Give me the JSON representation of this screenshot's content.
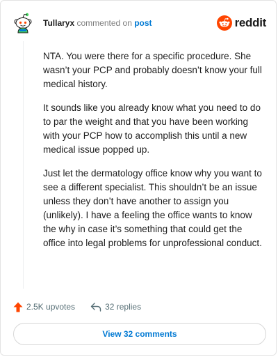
{
  "header": {
    "username": "Tullaryx",
    "verb": "commented on",
    "post_link": "post",
    "brand_wordmark": "reddit",
    "brand_color": "#ff4500"
  },
  "comment": {
    "paragraphs": [
      "NTA. You were there for a specific procedure. She wasn’t your PCP and probably doesn’t know your full medical history.",
      "It sounds like you already know what you need to do to par the weight and that you have been working with your PCP how to accomplish this until a new medical issue popped up.",
      "Just let the dermatology office know why you want to see a different specialist. This shouldn’t be an issue unless they don’t have another to assign you (unlikely). I have a feeling the office wants to know the why in case it’s something that could get the office into legal problems for unprofessional conduct."
    ]
  },
  "footer": {
    "upvotes": "2.5K upvotes",
    "replies": "32 replies",
    "view_comments": "View 32 comments",
    "upvote_icon": "upvote-arrow-icon",
    "reply_icon": "reply-arrow-icon",
    "accent_color": "#ff4500",
    "link_color": "#0079d3"
  }
}
